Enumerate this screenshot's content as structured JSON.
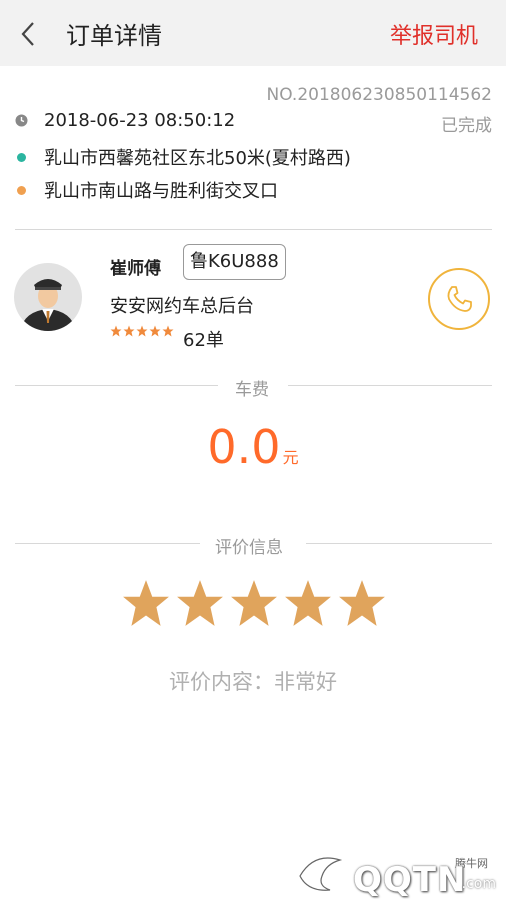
{
  "header": {
    "title": "订单详情",
    "report_label": "举报司机"
  },
  "order": {
    "number": "NO.201806230850114562",
    "status": "已完成",
    "time": "2018-06-23 08:50:12",
    "start": "乳山市西馨苑社区东北50米(夏村路西)",
    "end": "乳山市南山路与胜利街交叉口"
  },
  "driver": {
    "name": "崔师傅",
    "plate": "鲁K6U888",
    "company": "安安网约车总后台",
    "rating": 5,
    "orders": "62单"
  },
  "fare": {
    "section_title": "车费",
    "amount": "0.0",
    "unit": "元"
  },
  "review": {
    "section_title": "评价信息",
    "stars": 5,
    "content": "评价内容：非常好"
  },
  "watermark": {
    "small": "腾牛网",
    "main": "QQTN",
    "suffix": ".com"
  },
  "colors": {
    "accent_red": "#e0302a",
    "fare_orange": "#ff6a2a",
    "star_tan": "#e0a45c",
    "phone_gold": "#f0b43c",
    "start_dot": "#2bb5a0",
    "end_dot": "#f0a050"
  }
}
